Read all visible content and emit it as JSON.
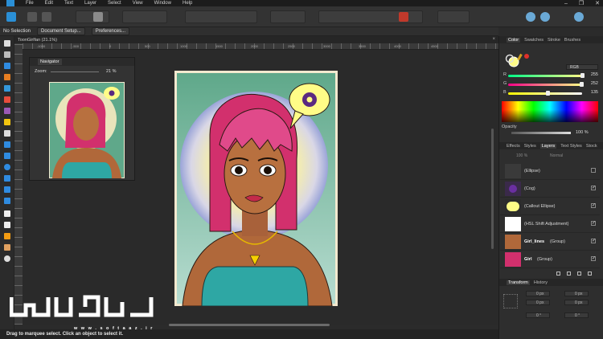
{
  "menubar": {
    "items": [
      "File",
      "Edit",
      "Text",
      "Layer",
      "Select",
      "View",
      "Window",
      "Help"
    ],
    "window_controls": [
      "–",
      "❐",
      "✕"
    ]
  },
  "context": {
    "selection": "No Selection",
    "document_setup": "Document Setup...",
    "preferences": "Preferences..."
  },
  "document": {
    "tab_label": "ToonGirlfan (21.1%)",
    "close": "×"
  },
  "rulers": {
    "top_ticks": [
      "-1000",
      "-500",
      "0",
      "500",
      "1000",
      "1500",
      "2000",
      "2500",
      "3000",
      "3500",
      "4000",
      "4500"
    ]
  },
  "navigator": {
    "tab": "Navigator",
    "zoom_label": "Zoom:",
    "zoom_value": "21 %"
  },
  "color_panel": {
    "tabs": [
      "Color",
      "Swatches",
      "Stroke",
      "Brushes"
    ],
    "model": "RGB",
    "sliders": [
      {
        "label": "R",
        "value": "255"
      },
      {
        "label": "G",
        "value": "252"
      },
      {
        "label": "B",
        "value": "135"
      }
    ],
    "opacity_label": "Opacity",
    "opacity_value": "100 %",
    "fill_color": "#fffc87",
    "stroke_color": "#e0302a"
  },
  "layers_panel": {
    "tabs": [
      "Effects",
      "Styles",
      "Layers",
      "Text Styles",
      "Stock"
    ],
    "opacity": "100 %",
    "blend_mode": "Normal",
    "layers": [
      {
        "name": "(Ellipse)",
        "checked": false
      },
      {
        "name": "(Cog)",
        "checked": true
      },
      {
        "name": "(Callout Ellipse)",
        "checked": true
      },
      {
        "name": "(HSL Shift Adjustment)",
        "checked": true
      },
      {
        "name": "Girl_lines",
        "suffix": "(Group)",
        "checked": true
      },
      {
        "name": "Girl",
        "suffix": "(Group)",
        "checked": true
      }
    ]
  },
  "transform_panel": {
    "tabs": [
      "Transform",
      "History"
    ],
    "fields": [
      "0 px",
      "0 px",
      "0 px",
      "0 px",
      "0 °",
      "0 °"
    ]
  },
  "statusbar": {
    "hint": "Drag to marquee select. Click an object to select it."
  },
  "watermark": {
    "brand_text": "w w w . s o f t a a z . i r"
  }
}
